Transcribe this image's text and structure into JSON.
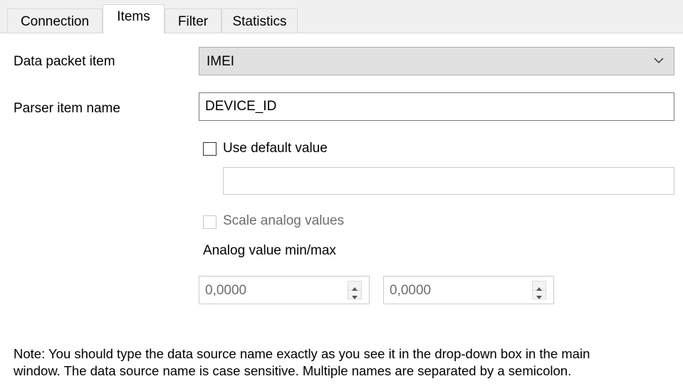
{
  "tabs": [
    {
      "label": "Connection",
      "active": false
    },
    {
      "label": "Items",
      "active": true
    },
    {
      "label": "Filter",
      "active": false
    },
    {
      "label": "Statistics",
      "active": false
    }
  ],
  "data_packet_item": {
    "label": "Data packet item",
    "value": "IMEI"
  },
  "parser_item_name": {
    "label": "Parser item name",
    "value": "DEVICE_ID"
  },
  "use_default_value": {
    "label": "Use default value",
    "checked": false,
    "value": ""
  },
  "scale_analog_values": {
    "label": "Scale analog values",
    "checked": false,
    "enabled": false
  },
  "analog_minmax": {
    "label": "Analog value min/max",
    "min": "0,0000",
    "max": "0,0000"
  },
  "note": {
    "line1": "Note: You should type the data source name exactly as you see it in the drop-down box in the main",
    "line2": "window. The data source name is case sensitive. Multiple names are separated by a semicolon."
  },
  "icons": {
    "dropdown": "chevron-down-icon",
    "spin_up": "triangle-up-icon",
    "spin_down": "triangle-down-icon"
  }
}
